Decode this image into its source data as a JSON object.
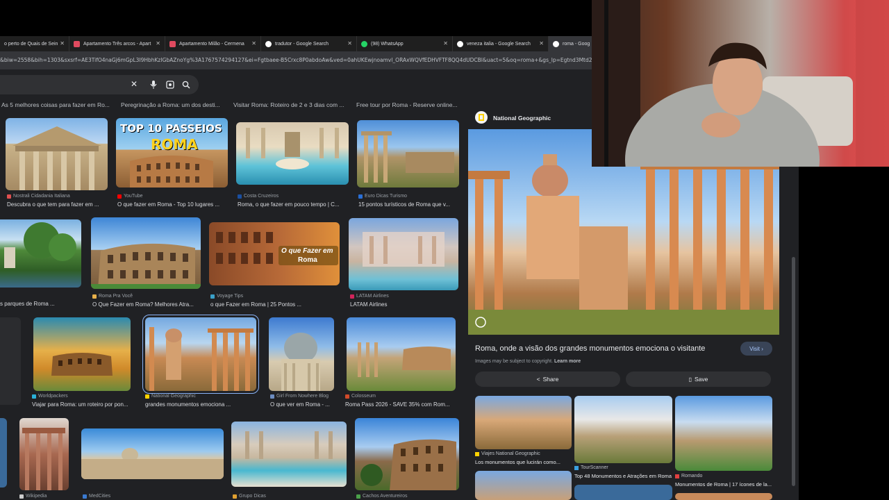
{
  "tabs": [
    {
      "title": "o perto de Quais de Sein",
      "fav": "#e04a5f"
    },
    {
      "title": "Apartamento Três arcos - Apart",
      "fav": "#e04a5f"
    },
    {
      "title": "Apartamento Milão - Cermena",
      "fav": "#e04a5f"
    },
    {
      "title": "tradutor - Google Search",
      "fav": "#ffffff"
    },
    {
      "title": "(98) WhatsApp",
      "fav": "#25d366"
    },
    {
      "title": "veneza italia - Google Search",
      "fav": "#ffffff"
    },
    {
      "title": "roma - Goog",
      "fav": "#ffffff"
    }
  ],
  "url": "&biw=2558&bih=1303&sxsrf=AE3TifO4naGj6mGpL3I9HbhKzIGbAZnoYg%3A1767574294127&ei=Fgtbaee-B5Crxc8P0abdoAw&ved=0ahUKEwjnoamvl_ORAxWQVfEDHVFTF8QQ4dUDCBI&uact=5&oq=roma+&gs_lp=Egtnd3Mtd2l6LWltZyll",
  "search": {
    "clear_icon": "✕",
    "mic_icon": "mic-icon",
    "lens_icon": "lens-icon",
    "search_icon": "search-icon"
  },
  "top_captions": [
    "As 5 melhores coisas para fazer em Ro...",
    "Peregrinação a Roma: um dos desti...",
    "Visitar Roma: Roteiro de 2 e 3 dias com ...",
    "Free tour por Roma - Reserve online..."
  ],
  "results": [
    {
      "source": "Nostrali Cidadania Italiana",
      "title": "Descubra o que tem para fazer em ...",
      "sfav": "#e05050"
    },
    {
      "source": "YouTube",
      "title": "O que fazer em Roma - Top 10 lugares ...",
      "sfav": "#ff0000",
      "overlay1": "TOP 10 PASSEIOS",
      "overlay2": "ROMA"
    },
    {
      "source": "Costa Cruzeiros",
      "title": "Roma, o que fazer em pouco tempo | C...",
      "sfav": "#1a4fa0"
    },
    {
      "source": "Euro Dicas Turismo",
      "title": "15 pontos turísticos de Roma que v...",
      "sfav": "#2a6fd6"
    },
    {
      "source": "",
      "title": "s parques de Roma ...",
      "sfav": "#888"
    },
    {
      "source": "Roma Pra Você",
      "title": "O Que Fazer em Roma? Melhores Atra...",
      "sfav": "#e8b04a"
    },
    {
      "source": "Voyage Tips",
      "title": "o que Fazer em Roma | 25 Pontos ...",
      "sfav": "#3aa0c8",
      "overlay1": "O que Fazer em",
      "overlay2": "Roma"
    },
    {
      "source": "LATAM Airlines",
      "title": "LATAM Airlines",
      "sfav": "#d0245a"
    },
    {
      "source": "Worldpackers",
      "title": "Viajar para Roma: um roteiro por pon...",
      "sfav": "#2ab0d8"
    },
    {
      "source": "National Geographic",
      "title": "grandes monumentos emociona ...",
      "sfav": "#ffd200"
    },
    {
      "source": "Girl From Nowhere Blog",
      "title": "O que ver em Roma - ...",
      "sfav": "#6c8cc0"
    },
    {
      "source": "Colosseum",
      "title": "Roma Pass 2026 - SAVE 35% com Rom...",
      "sfav": "#d04a2a"
    },
    {
      "source": "Wikipedia",
      "title": "",
      "sfav": "#cccccc"
    },
    {
      "source": "MedCities",
      "title": "",
      "sfav": "#3a7ad0"
    },
    {
      "source": "Grupo Dicas",
      "title": "",
      "sfav": "#e0a030"
    },
    {
      "source": "Cachos Aventureiros",
      "title": "",
      "sfav": "#4aa04a"
    }
  ],
  "panel": {
    "source": "National Geographic",
    "title": "Roma, onde a visão dos grandes monumentos emociona o visitante",
    "visit": "Visit ›",
    "copyright": "Images may be subject to copyright.",
    "learn_more": "Learn more",
    "share": "Share",
    "save": "Save",
    "related": [
      {
        "source": "Viajes National Geographic",
        "title": "Los monumentos que lucirán como...",
        "sfav": "#ffd200"
      },
      {
        "source": "TourScanner",
        "title": "Top 48 Monumentos e Atrações em Roma",
        "sfav": "#3aa0e0"
      },
      {
        "source": "Romando",
        "title": "Monumentos de Roma | 17 ícones de la...",
        "sfav": "#e04040"
      }
    ]
  },
  "colors": {
    "page_bg": "#202124",
    "accent": "#8ab4f8"
  }
}
